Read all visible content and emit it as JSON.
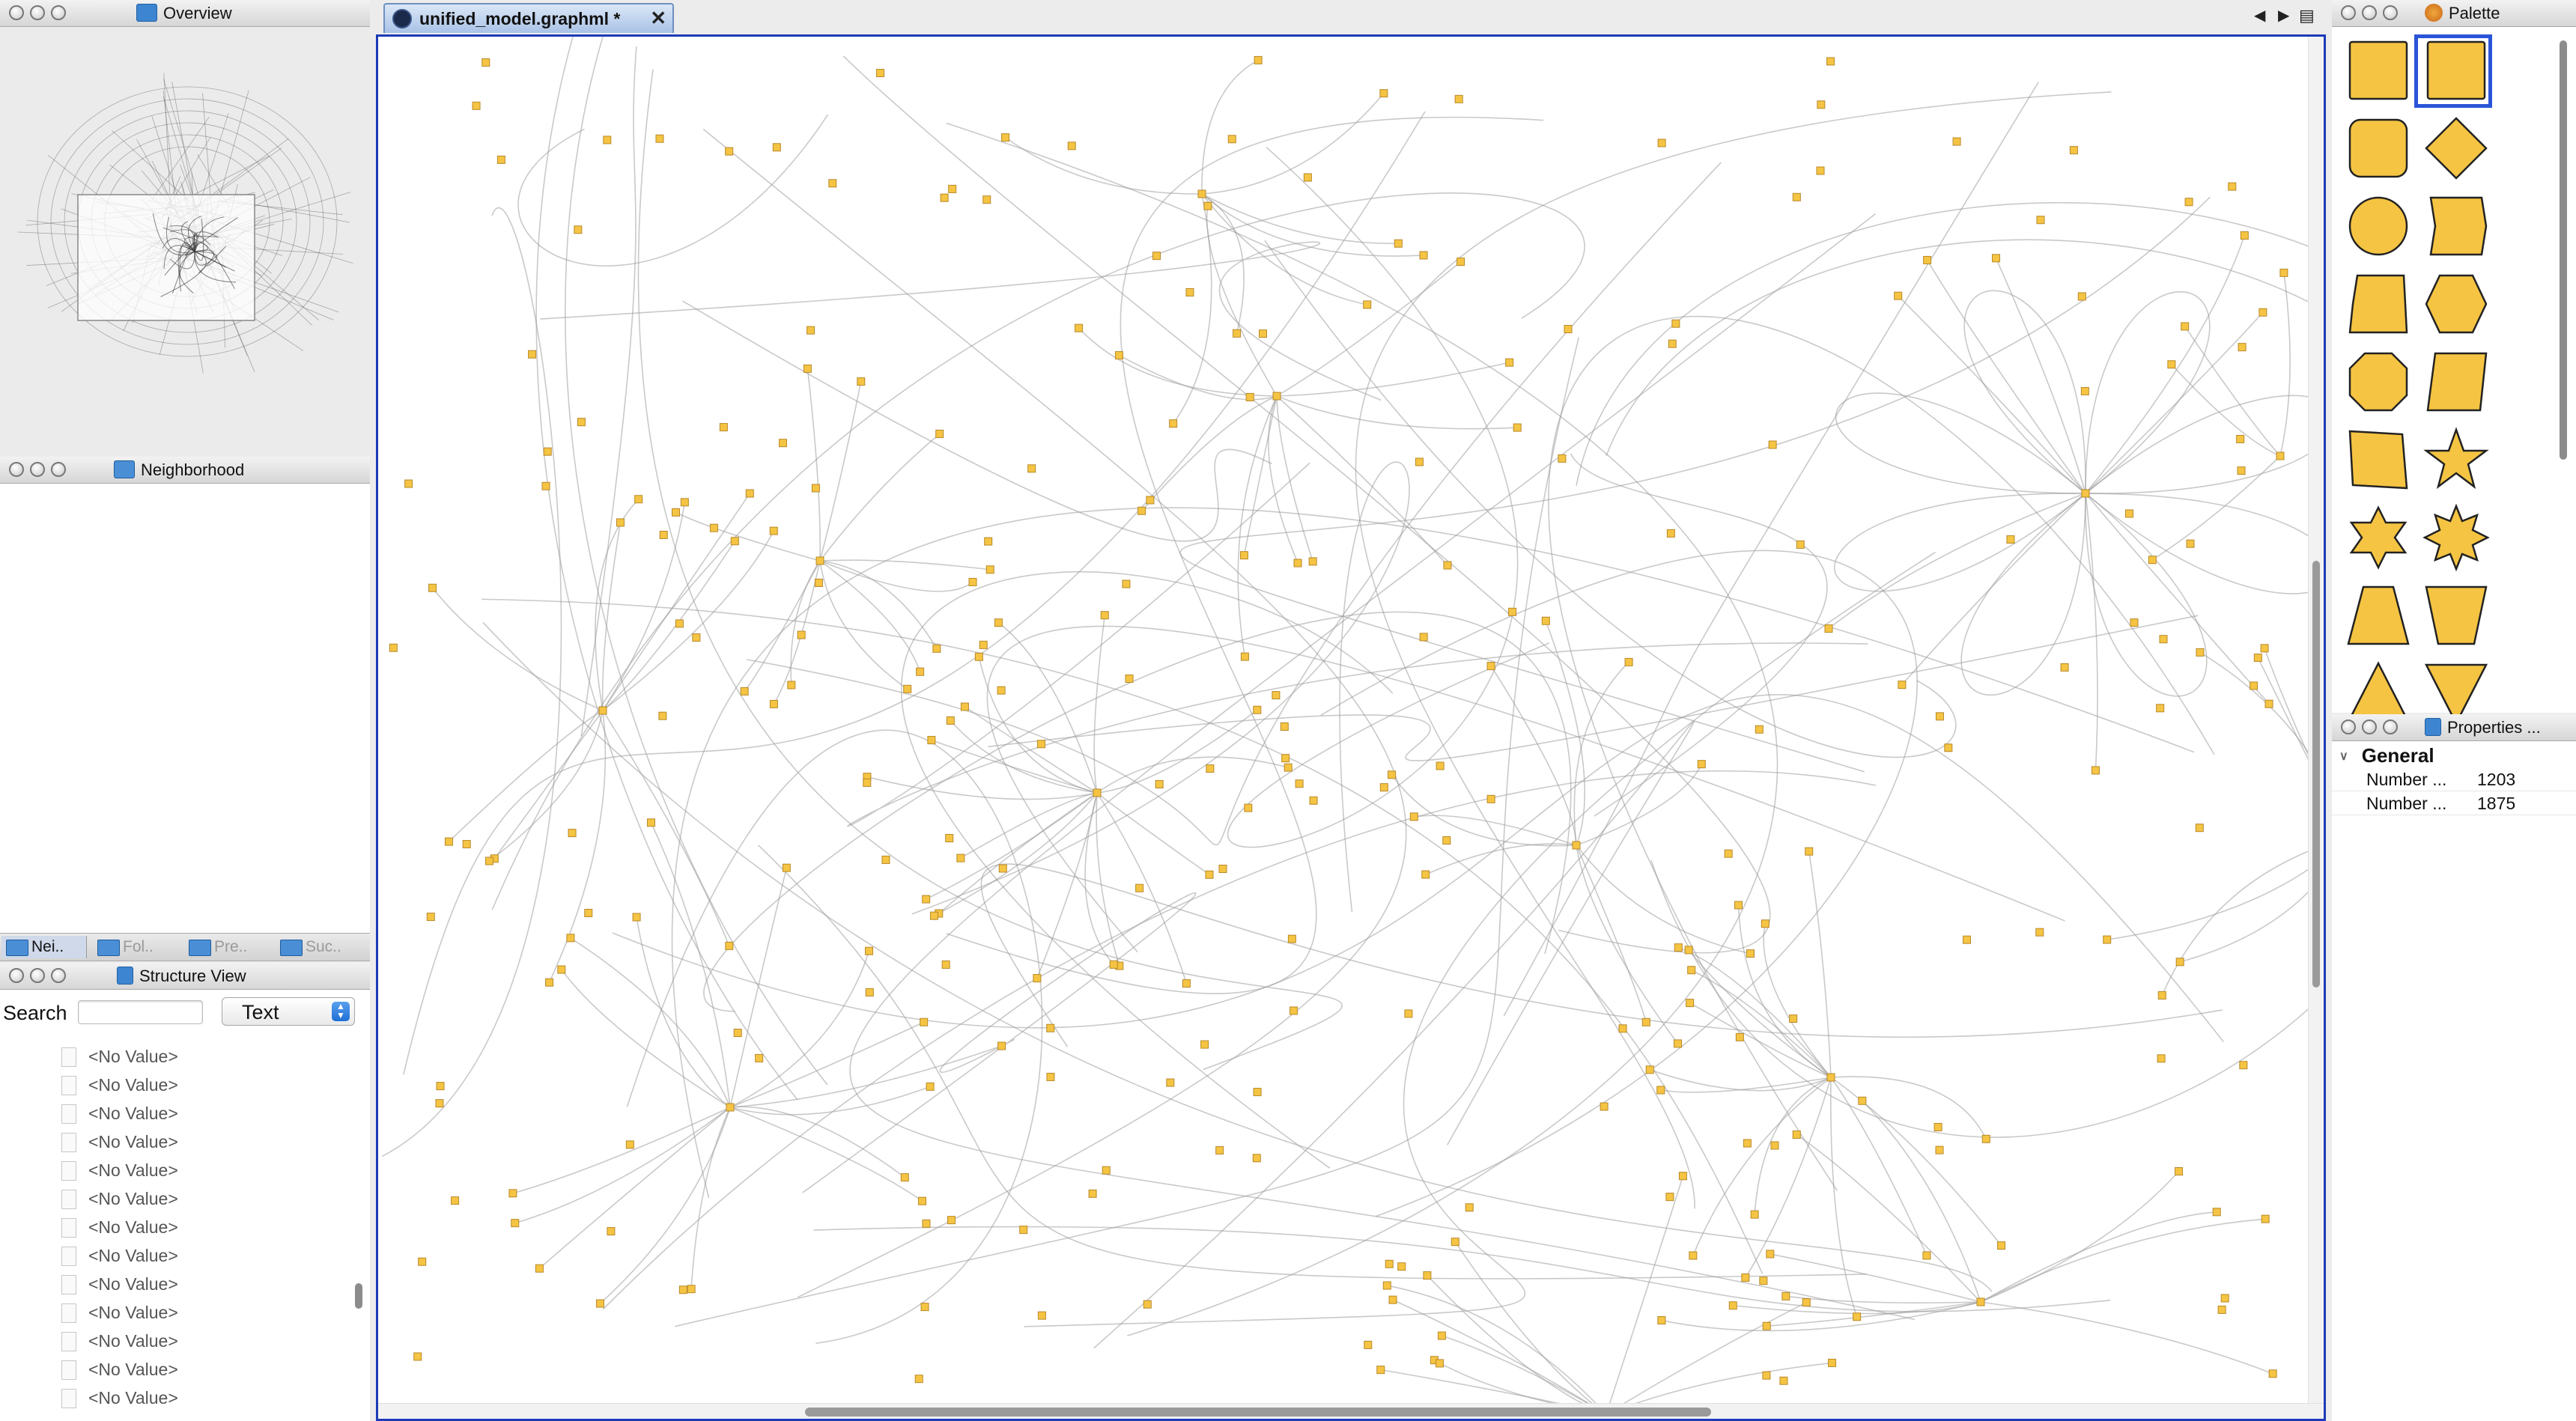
{
  "overview": {
    "title": "Overview"
  },
  "neighborhood": {
    "title": "Neighborhood"
  },
  "view_tabs": [
    {
      "label": "Nei.."
    },
    {
      "label": "Fol.."
    },
    {
      "label": "Pre.."
    },
    {
      "label": "Suc.."
    }
  ],
  "structure": {
    "title": "Structure View",
    "search_label": "Search",
    "search_value": "",
    "mode_selected": "Text",
    "rows": [
      "<No Value>",
      "<No Value>",
      "<No Value>",
      "<No Value>",
      "<No Value>",
      "<No Value>",
      "<No Value>",
      "<No Value>",
      "<No Value>",
      "<No Value>",
      "<No Value>",
      "<No Value>",
      "<No Value>"
    ]
  },
  "editor": {
    "tab_label": "unified_model.graphml",
    "tab_modified": "*",
    "close_glyph": "✕",
    "node_color": "#f5c443",
    "edge_color": "#9c9c9c",
    "selection_border_color": "#1c3bb8"
  },
  "palette": {
    "title": "Palette",
    "shape_fill": "#f5c443",
    "shapes": [
      "rectangle",
      "rectangle-selected",
      "rounded-rectangle",
      "diamond",
      "ellipse",
      "parallelogram-banner",
      "parallelogram-left",
      "hexagon",
      "octagon",
      "parallelogram-right",
      "parallelogram-skew",
      "star5",
      "star6",
      "star8",
      "trapezoid",
      "trapezoid-inverted",
      "triangle",
      "triangle-down"
    ]
  },
  "properties": {
    "title": "Properties ...",
    "group": "General",
    "rows": [
      {
        "key": "Number ...",
        "value": "1203"
      },
      {
        "key": "Number ...",
        "value": "1875"
      }
    ]
  }
}
